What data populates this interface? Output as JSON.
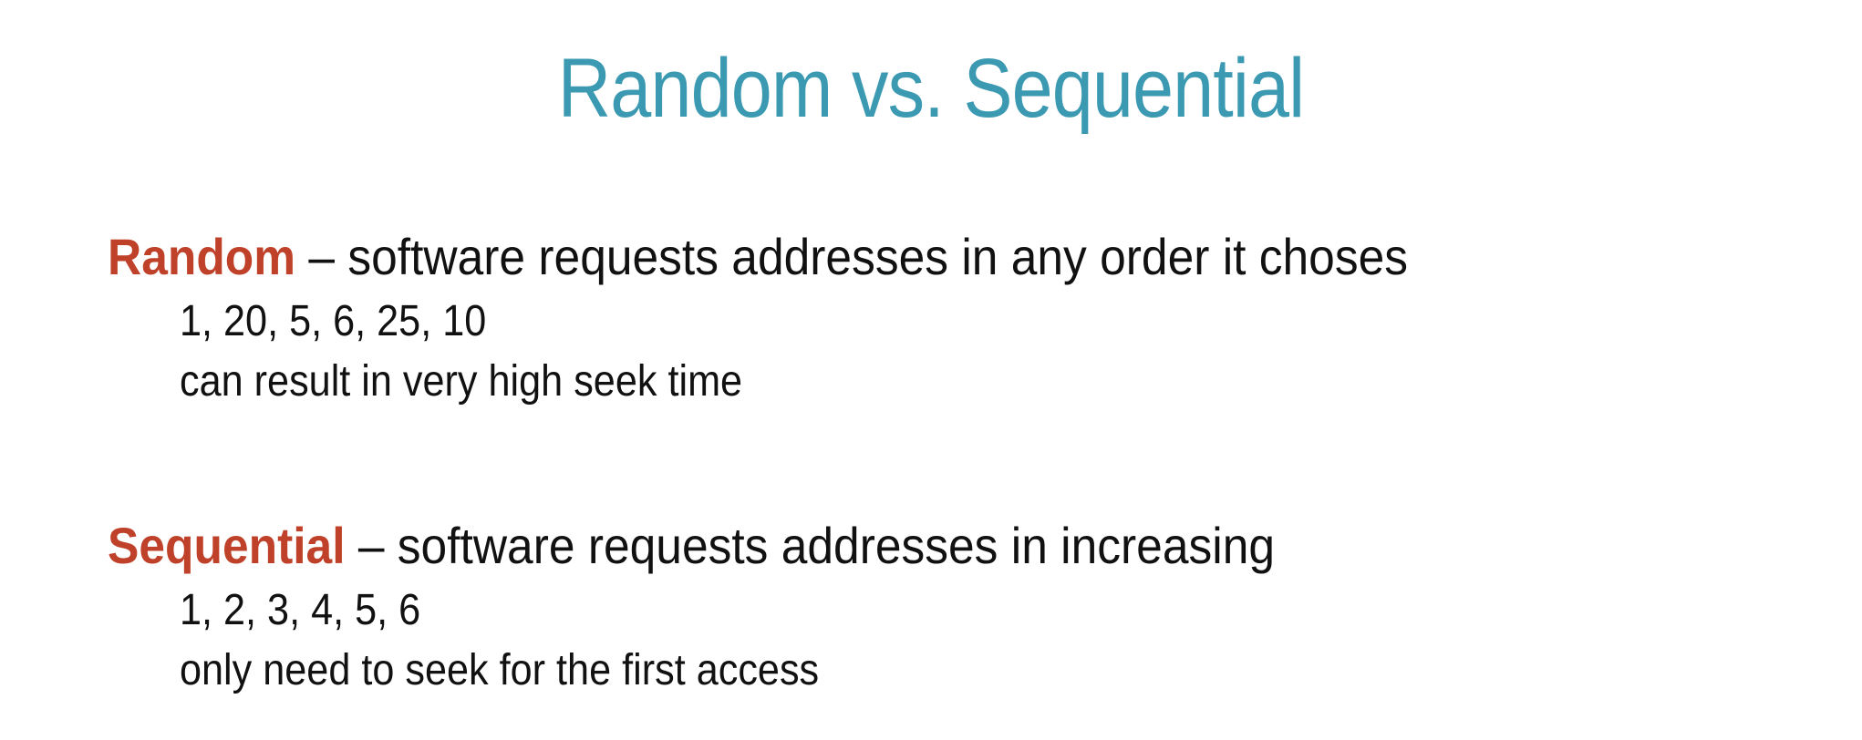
{
  "slide": {
    "title": "Random vs. Sequential",
    "colors": {
      "title": "#3b9ab2",
      "term": "#c0412a",
      "body": "#111111",
      "background": "#ffffff"
    },
    "random": {
      "term": "Random",
      "definition": " – software requests addresses in any order it choses",
      "example": "1, 20, 5, 6, 25, 10",
      "note": "can result in very high seek time"
    },
    "sequential": {
      "term": "Sequential",
      "definition": " – software requests addresses in increasing",
      "example": "1, 2, 3, 4, 5, 6",
      "note": "only need to seek for the first access"
    }
  }
}
